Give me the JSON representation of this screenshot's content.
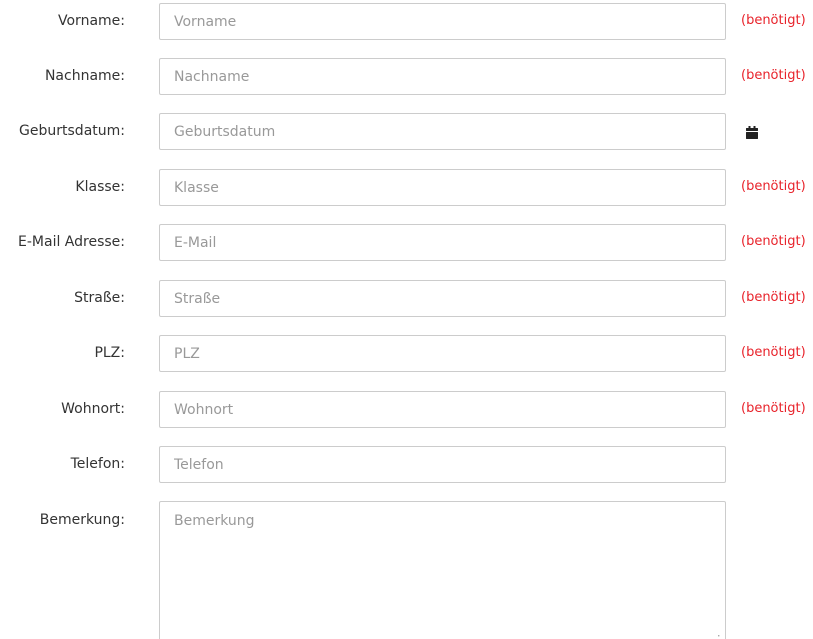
{
  "form": {
    "required_text": "(benötigt)",
    "fields": {
      "vorname": {
        "label": "Vorname:",
        "placeholder": "Vorname"
      },
      "nachname": {
        "label": "Nachname:",
        "placeholder": "Nachname"
      },
      "geburtsdatum": {
        "label": "Geburtsdatum:",
        "placeholder": "Geburtsdatum",
        "icon": "calendar-icon"
      },
      "klasse": {
        "label": "Klasse:",
        "placeholder": "Klasse"
      },
      "email": {
        "label": "E-Mail Adresse:",
        "placeholder": "E-Mail"
      },
      "strasse": {
        "label": "Straße:",
        "placeholder": "Straße"
      },
      "plz": {
        "label": "PLZ:",
        "placeholder": "PLZ"
      },
      "wohnort": {
        "label": "Wohnort:",
        "placeholder": "Wohnort"
      },
      "telefon": {
        "label": "Telefon:",
        "placeholder": "Telefon"
      },
      "bemerkung": {
        "label": "Bemerkung:",
        "placeholder": "Bemerkung"
      }
    },
    "colors": {
      "required": "#e8232b",
      "border": "#cccccc",
      "placeholder": "#999999",
      "label": "#333333"
    }
  }
}
